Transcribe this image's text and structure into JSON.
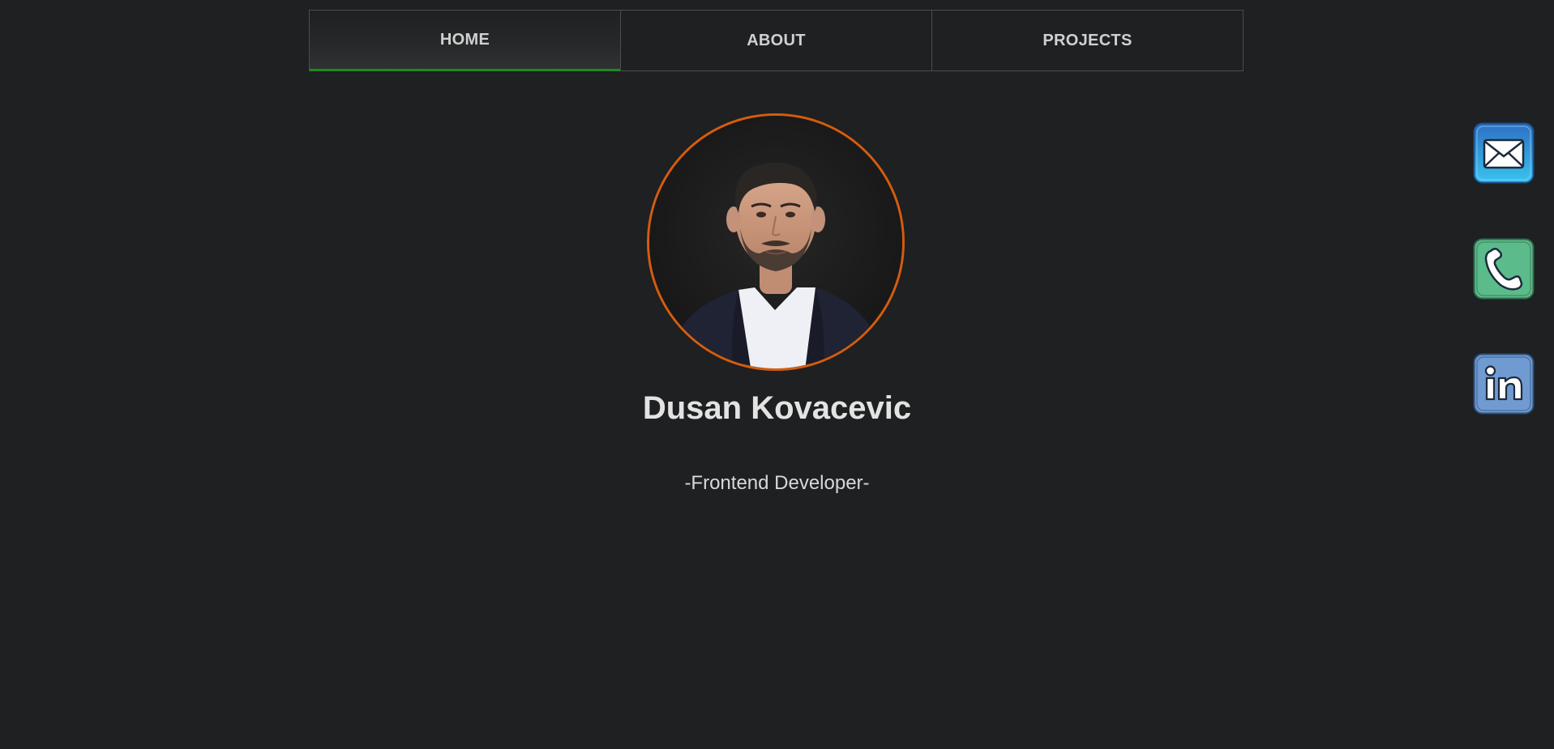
{
  "nav": {
    "tabs": [
      {
        "label": "HOME",
        "active": true
      },
      {
        "label": "ABOUT",
        "active": false
      },
      {
        "label": "PROJECTS",
        "active": false
      }
    ],
    "active_indicator_color": "#1e8c1e"
  },
  "profile": {
    "avatar_icon": "profile-photo",
    "avatar_border_color": "#d55c0e",
    "name": "Dusan Kovacevic",
    "role": "-Frontend Developer-"
  },
  "social": [
    {
      "icon": "mail-icon",
      "color": "#2f9fe0"
    },
    {
      "icon": "phone-icon",
      "color": "#5cbb8a"
    },
    {
      "icon": "linkedin-icon",
      "color": "#6f9bd1"
    }
  ],
  "colors": {
    "background": "#1e2021",
    "text": "#e3e3e3"
  }
}
